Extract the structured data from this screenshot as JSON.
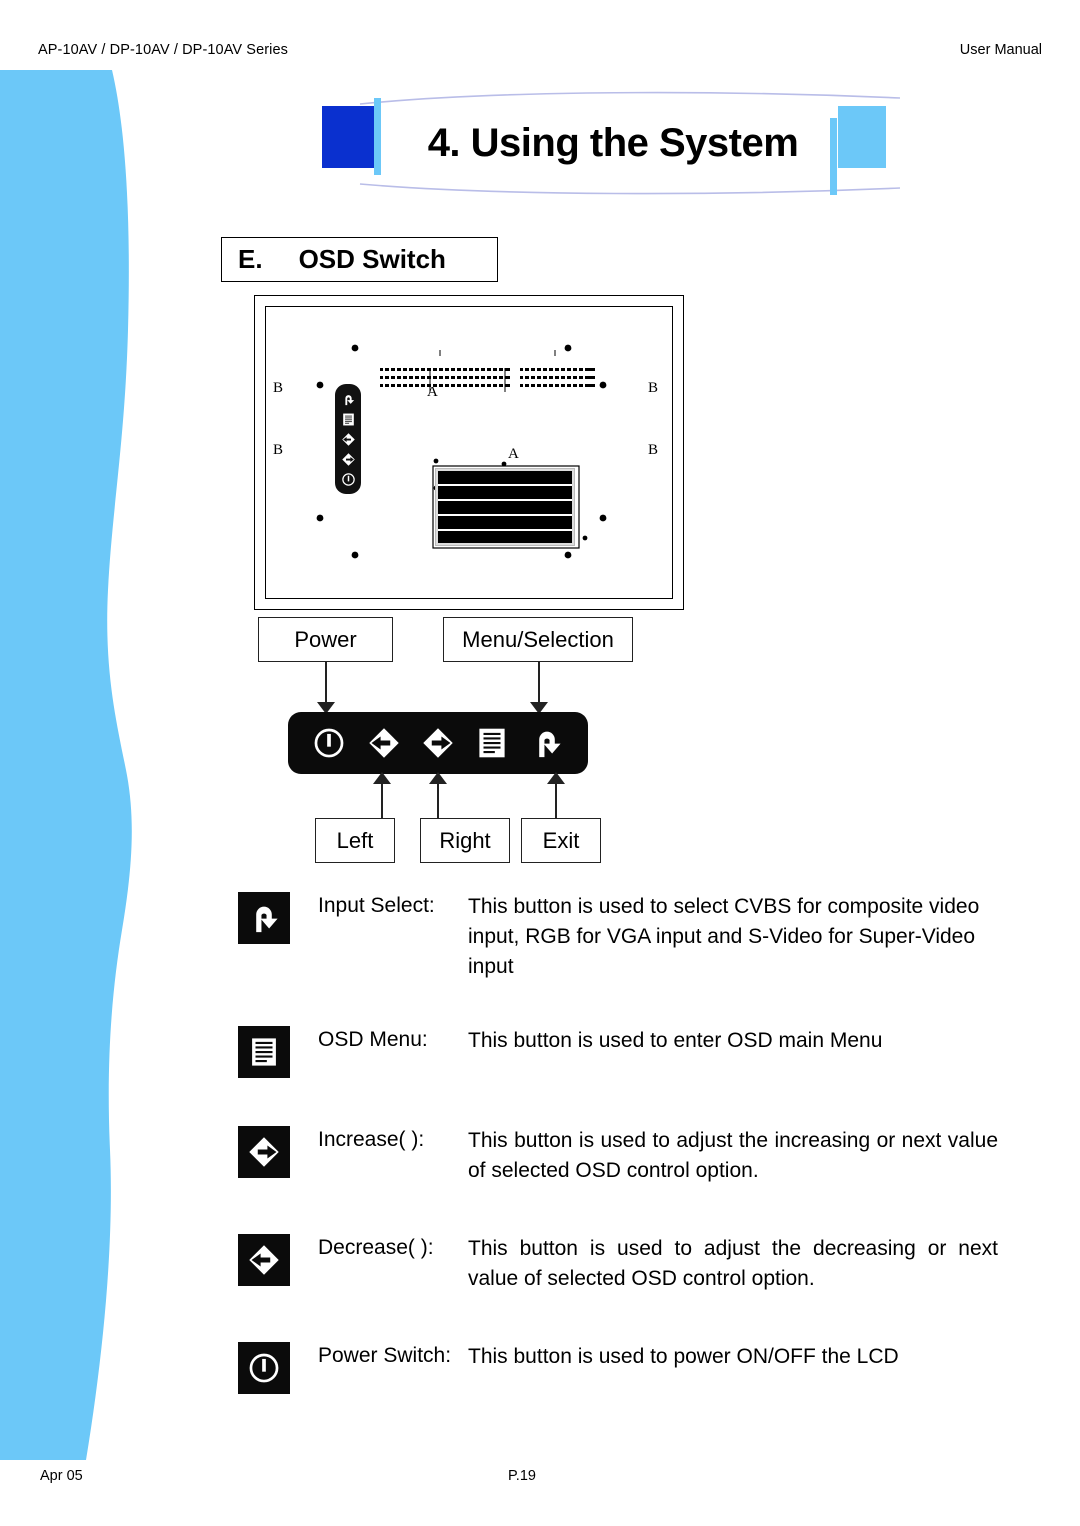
{
  "header": {
    "left": "AP-10AV / DP-10AV / DP-10AV Series",
    "right": "User Manual"
  },
  "banner": {
    "title": "4. Using the System",
    "dark_blue": "#0A30CF",
    "light_blue": "#6CC8F8"
  },
  "section": {
    "letter": "E.",
    "name": "OSD Switch"
  },
  "diagram": {
    "callouts": {
      "power": "Power",
      "menu_selection": "Menu/Selection",
      "left": "Left",
      "right": "Right",
      "exit": "Exit"
    },
    "strip_buttons": [
      "power-switch-icon",
      "left-arrow-icon",
      "right-arrow-icon",
      "osd-menu-icon",
      "input-select-icon"
    ]
  },
  "descriptions": [
    {
      "icon": "input-select-icon",
      "term": "Input Select:",
      "text": "This button is used to select CVBS for composite video input, RGB for VGA input and S-Video for Super-Video input",
      "justify": false
    },
    {
      "icon": "osd-menu-icon",
      "term": "OSD Menu:",
      "text": "This button is used to enter OSD main Menu",
      "justify": false
    },
    {
      "icon": "right-arrow-icon",
      "term": "Increase(  ):",
      "text": "This button is used to adjust the increasing or next value of selected OSD control option.",
      "justify": true
    },
    {
      "icon": "left-arrow-icon",
      "term": "Decrease(  ):",
      "text": "This button is used to adjust the decreasing or next value of selected OSD control option.",
      "justify": true
    },
    {
      "icon": "power-switch-icon",
      "term": "Power Switch:",
      "text": "This button is used to power ON/OFF the LCD",
      "justify": false
    }
  ],
  "footer": {
    "left": "Apr 05",
    "center": "P.19"
  },
  "sidebar": {
    "color": "#6CC8F8"
  }
}
